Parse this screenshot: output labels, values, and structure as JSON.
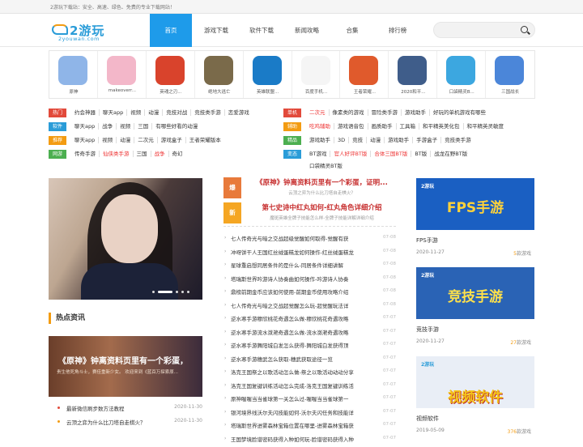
{
  "topbar": {
    "text": "2游玩下载站：安全、高速、绿色、免费的专业下载网站！"
  },
  "logo": {
    "main": "2游玩",
    "sub": "2youwan.com"
  },
  "nav": [
    {
      "label": "首页",
      "active": true
    },
    {
      "label": "游戏下载"
    },
    {
      "label": "软件下载"
    },
    {
      "label": "新闻攻略"
    },
    {
      "label": "合集"
    },
    {
      "label": "排行榜"
    }
  ],
  "search": {
    "placeholder": ""
  },
  "games": [
    {
      "name": "原神",
      "color": "#8fb5e8"
    },
    {
      "name": "makeoverr...",
      "color": "#f3b7c9"
    },
    {
      "name": "英魂之刃...",
      "color": "#d9432c"
    },
    {
      "name": "绝地大逃亡",
      "color": "#7a6a4a"
    },
    {
      "name": "英雄联盟...",
      "color": "#1a7bc7"
    },
    {
      "name": "百度手机...",
      "color": "#f5f5f5"
    },
    {
      "name": "王者荣耀...",
      "color": "#e05a2c"
    },
    {
      "name": "2020和平...",
      "color": "#3f5d8a"
    },
    {
      "name": "口袋精灵B...",
      "color": "#3ca7e0"
    },
    {
      "name": "三国战长",
      "color": "#4b86d9"
    }
  ],
  "tags": {
    "left": [
      {
        "badge": "热门",
        "color": "#e24a3b",
        "items": [
          "约会神器",
          "聊天app",
          "视频",
          "动漫",
          "竞技对战",
          "竞技类手游",
          "恋爱游戏"
        ]
      },
      {
        "badge": "软件",
        "color": "#2a9cd8",
        "items": [
          "聊天app",
          "战争",
          "视频",
          "三国",
          "有哪些好看的动漫"
        ]
      },
      {
        "badge": "推荐",
        "color": "#f39c12",
        "items": [
          "聊天app",
          "视频",
          "动漫",
          "二次元",
          "游戏盒子",
          "王者荣耀版本"
        ]
      },
      {
        "badge": "网游",
        "color": "#4caf50",
        "items": [
          "传奇手游",
          "仙侠类手游",
          "三国",
          "战争",
          "奇幻"
        ]
      }
    ],
    "right": [
      {
        "badge": "单机",
        "color": "#e24a3b",
        "items": [
          "二次元",
          "像素类的游戏",
          "冒险类手游",
          "游戏助手",
          "好玩的单机游戏有哪些"
        ]
      },
      {
        "badge": "辅助",
        "color": "#f39c12",
        "items": [
          "吃鸡辅助",
          "游戏语音包",
          "画质助手",
          "工具箱",
          "和平精英美化包",
          "和平精英灵敏度"
        ]
      },
      {
        "badge": "精品",
        "color": "#4caf50",
        "items": [
          "游戏助手",
          "3D",
          "竞技",
          "动漫",
          "游戏助手",
          "手游盒子",
          "竞技类手游"
        ]
      },
      {
        "badge": "变态",
        "color": "#2a9cd8",
        "items": [
          "BT游戏",
          "官人好评BT版",
          "合体三国BT版",
          "BT版",
          "战龙在野BT版",
          "口袋精灵BT版"
        ]
      }
    ]
  },
  "slider": {
    "dots": 5,
    "active_dot": 1
  },
  "hot": {
    "title": "热点资讯",
    "img_title": "《原神》钟离资料页里有一个彩蛋，",
    "img_sub": "贵生他死角斗士，赛佳重新少女。 欢迎来到《蓝百万探索原...",
    "items": [
      {
        "text": "最新微信刷步数方法教程",
        "date": "2020-11-30",
        "color": "#e24a3b"
      },
      {
        "text": "云顶之弈为什么比刀塔自走棋火？",
        "date": "2020-11-30",
        "color": "#f39c12"
      }
    ]
  },
  "features": [
    {
      "badge": "爆",
      "color": "#e87a3b",
      "title": "《原神》钟离资料页里有一个彩蛋，证明...",
      "sub": "云顶之弈为什么比刀塔自走棋火？"
    },
    {
      "badge": "新",
      "color": "#f5a623",
      "title": "第七史诗中红丸如何-红丸角色详细介绍",
      "sub": "魔斑英雄全牌子技能怎么样-全牌子技能详解详细介绍"
    }
  ],
  "news": [
    {
      "text": "七人传奇光与暗之交战超级觉醒如何取得-觉醒有获",
      "date": "07-08"
    },
    {
      "text": "冲呀饼干人王国红丝绒蛋糕龙如何操作-红丝绒蛋糕龙",
      "date": "07-08"
    },
    {
      "text": "星球重启想同居条件的是什么-同居条件详细讲解",
      "date": "07-08"
    },
    {
      "text": "塔瑞斯世界吟游诗人协奏曲如何操作-吟游诗人协奏",
      "date": "07-08"
    },
    {
      "text": "鼎榜前期金币应该如何使用-前期金币使用攻略介绍",
      "date": "07-08"
    },
    {
      "text": "七人传奇光与暗之交战超觉醒怎么玩-超觉醒玩法详",
      "date": "07-08"
    },
    {
      "text": "逆水寒手游穆欣桃花奇遇怎么做-穆欣桃花奇遇攻略",
      "date": "07-07"
    },
    {
      "text": "逆水寒手游流水潋滟奇遇怎么做-流水潋滟奇遇攻略",
      "date": "07-07"
    },
    {
      "text": "逆水寒手游舞阳城白发怎么获得-舞阳城白发获得顶",
      "date": "07-07"
    },
    {
      "text": "逆水寒手游穗武怎么获取-穗武获取途径一览",
      "date": "07-07"
    },
    {
      "text": "洛克王国祭之以歌活动怎么做-祭之以歌活动动动分享",
      "date": "07-07"
    },
    {
      "text": "洛克王国复键训练活动怎么完成-洛克王国复键训练活",
      "date": "07-07"
    },
    {
      "text": "原神喔喔当当雀球第一关怎么过-喔喔当当雀球第一",
      "date": "07-07"
    },
    {
      "text": "银河境界线沃尔夫闪技能如何-沃尔夫闪任务和技能详",
      "date": "07-07"
    },
    {
      "text": "塔瑞斯世界进雾森林宝箱位置在哪里-进雾森林宝箱获",
      "date": "07-07"
    },
    {
      "text": "王国梦境脸谱密码获得入种如何玩-脸谱密码获得入种",
      "date": "07-07"
    }
  ],
  "right_cards": [
    {
      "big": "FPS手游",
      "caption": "FPS手游",
      "date": "2020-11-27",
      "count": "5",
      "unit": "款游戏",
      "bg": "#1a5fc2",
      "fg": "#ffd23a"
    },
    {
      "big": "竞技手游",
      "caption": "竞技手游",
      "date": "2020-11-27",
      "count": "27",
      "unit": "款游戏",
      "bg": "#2a63b5",
      "fg": "#ffe14a"
    },
    {
      "big": "视频软件",
      "caption": "视频软件",
      "date": "2019-05-09",
      "count": "376",
      "unit": "款游戏",
      "bg": "#e9eef6",
      "fg": "#f5c518"
    }
  ],
  "right_logo": "2游玩"
}
